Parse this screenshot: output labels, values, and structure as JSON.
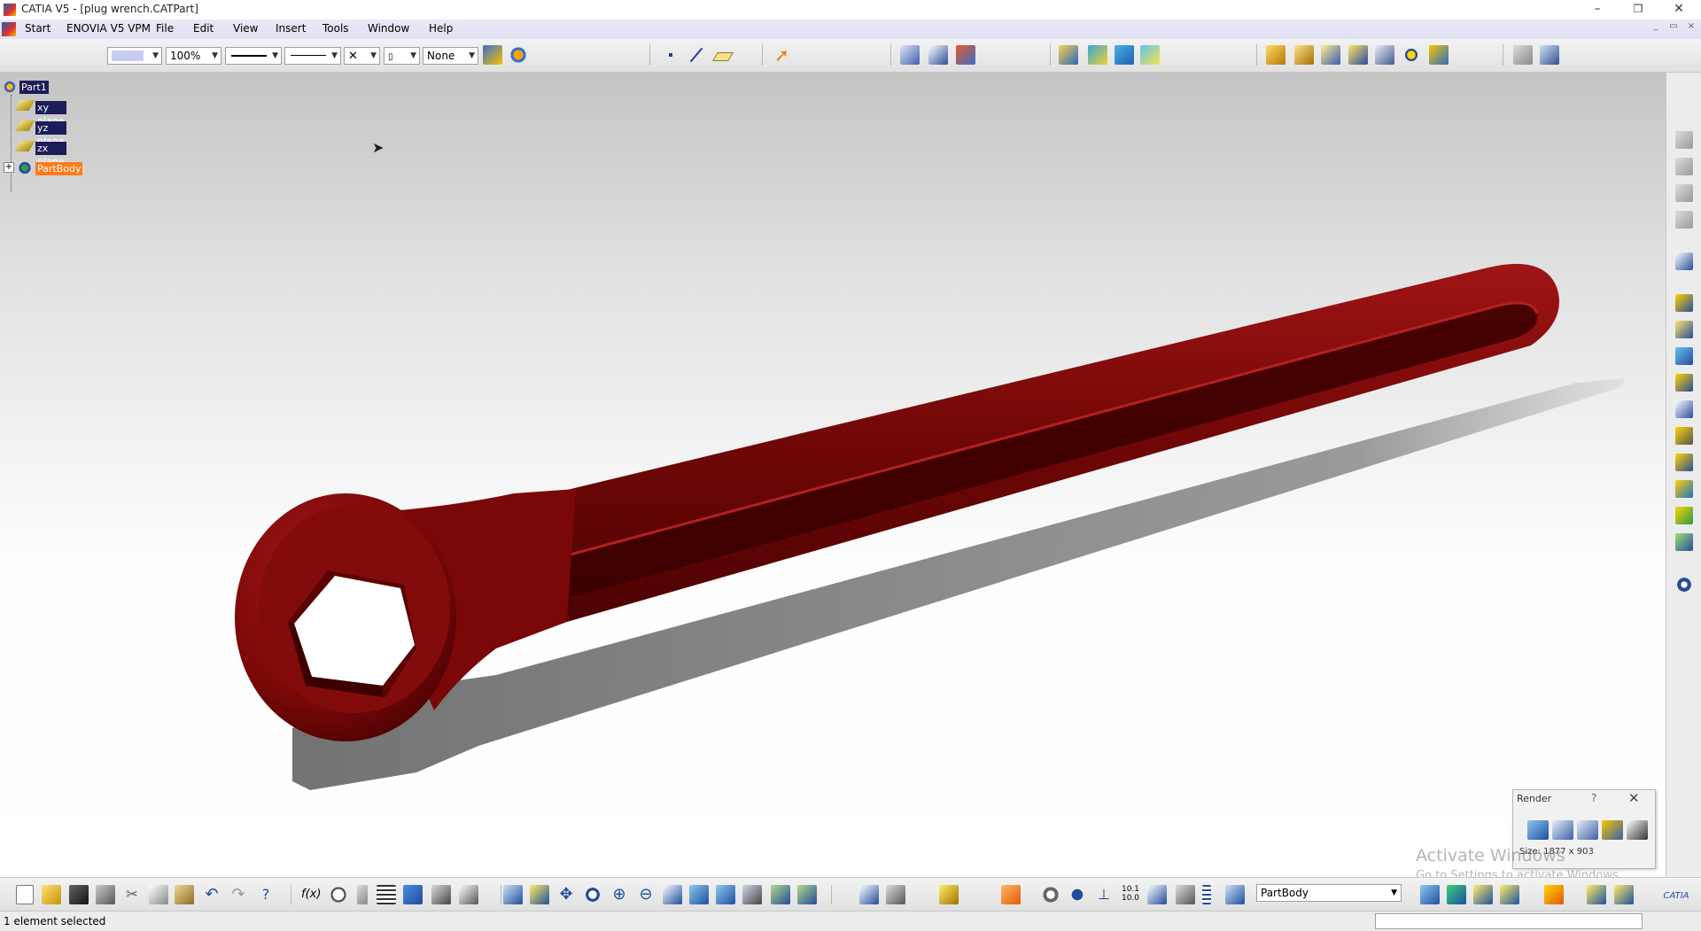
{
  "window": {
    "title": "CATIA V5 - [plug wrench.CATPart]",
    "minimize": "–",
    "restore": "❐",
    "close": "✕"
  },
  "menu": {
    "items": [
      "Start",
      "ENOVIA V5 VPM",
      "File",
      "Edit",
      "View",
      "Insert",
      "Tools",
      "Window",
      "Help"
    ]
  },
  "toolbar": {
    "zoom_value": "100%",
    "layer_value": "None"
  },
  "tree": {
    "root": "Part1",
    "items": [
      {
        "label": "xy plane",
        "type": "plane"
      },
      {
        "label": "yz plane",
        "type": "plane"
      },
      {
        "label": "zx plane",
        "type": "plane"
      },
      {
        "label": "PartBody",
        "type": "body",
        "selected": true
      }
    ],
    "expander": "+"
  },
  "model": {
    "name": "plug wrench",
    "color": "#8b0a0a"
  },
  "render_panel": {
    "title": "Render",
    "help": "?",
    "close": "✕",
    "size_text": "Size: 1877 x 903"
  },
  "watermark": {
    "line1": "Activate Windows",
    "line2": "Go to Settings to activate Windows."
  },
  "bottom_toolbar": {
    "current_body": "PartBody"
  },
  "status": {
    "text": "1 element selected"
  },
  "colors": {
    "accent_orange": "#ff7a1a",
    "tree_select": "#1c1c5a",
    "menu_bg": "#e2e3f3"
  }
}
